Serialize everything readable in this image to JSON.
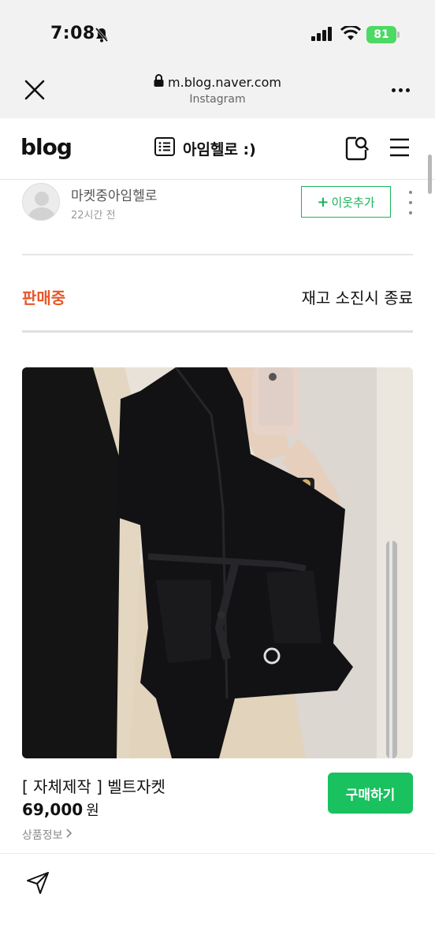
{
  "status_bar": {
    "time": "7:08",
    "battery": "81"
  },
  "browser": {
    "url": "m.blog.naver.com",
    "source": "Instagram"
  },
  "blog_header": {
    "logo": "blog",
    "title": "아임헬로 :)"
  },
  "author": {
    "name": "마켓중아임헬로",
    "time": "22시간 전",
    "follow_label": "이웃추가"
  },
  "sale": {
    "status": "판매중",
    "note": "재고 소진시 종료"
  },
  "product": {
    "name": "[ 자체제작 ] 벨트자켓",
    "price": "69,000",
    "price_unit": "원",
    "info_link": "상품정보",
    "buy_label": "구매하기"
  },
  "colors": {
    "accent_green": "#19c15f",
    "sale_orange": "#e8562a"
  }
}
